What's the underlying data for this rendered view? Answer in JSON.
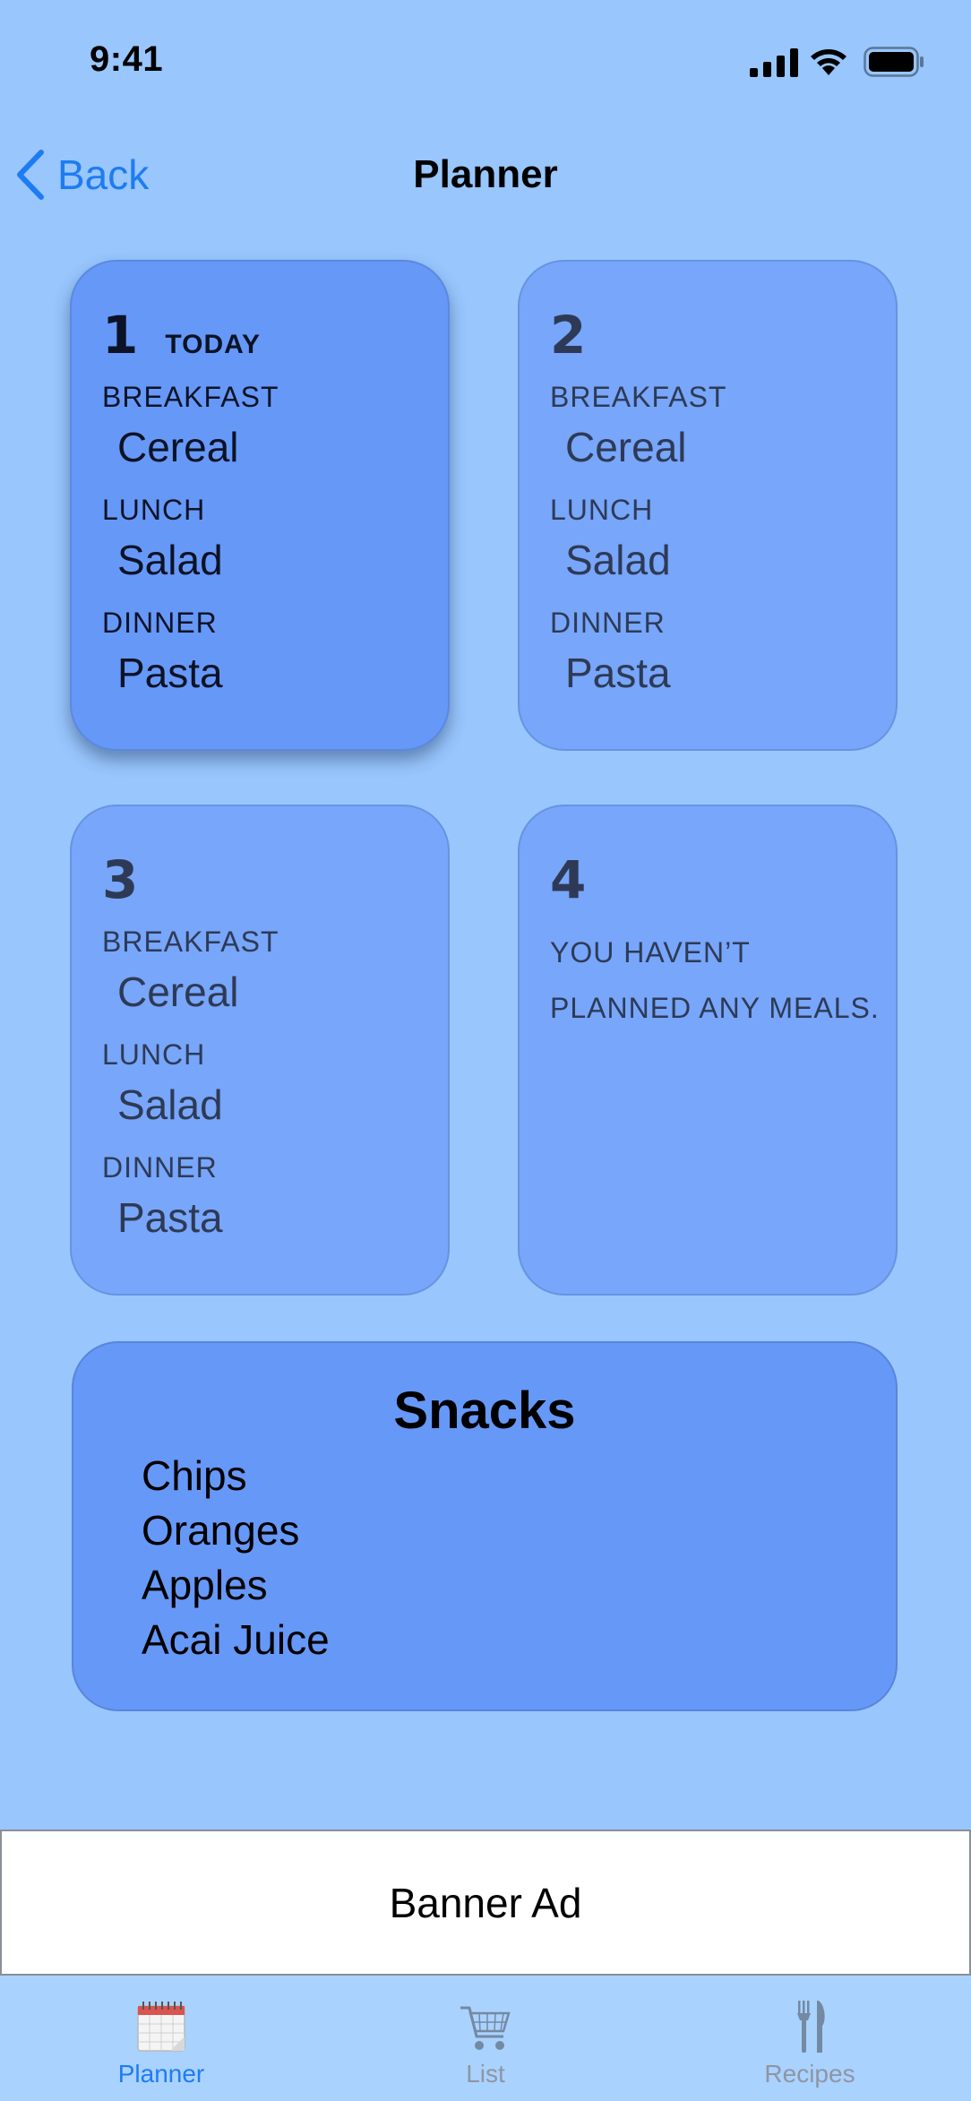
{
  "status_bar": {
    "time": "9:41"
  },
  "nav": {
    "back_label": "Back",
    "title": "Planner"
  },
  "days": [
    {
      "number": "1",
      "tag": "TODAY",
      "meals": [
        {
          "label": "BREAKFAST",
          "item": "Cereal"
        },
        {
          "label": "LUNCH",
          "item": "Salad"
        },
        {
          "label": "DINNER",
          "item": "Pasta"
        }
      ]
    },
    {
      "number": "2",
      "meals": [
        {
          "label": "BREAKFAST",
          "item": "Cereal"
        },
        {
          "label": "LUNCH",
          "item": "Salad"
        },
        {
          "label": "DINNER",
          "item": "Pasta"
        }
      ]
    },
    {
      "number": "3",
      "meals": [
        {
          "label": "BREAKFAST",
          "item": "Cereal"
        },
        {
          "label": "LUNCH",
          "item": "Salad"
        },
        {
          "label": "DINNER",
          "item": "Pasta"
        }
      ]
    },
    {
      "number": "4",
      "empty_line1": "YOU HAVEN’T",
      "empty_line2": "PLANNED ANY MEALS."
    }
  ],
  "snacks": {
    "title": "Snacks",
    "items": [
      "Chips",
      "Oranges",
      "Apples",
      "Acai Juice"
    ]
  },
  "banner": {
    "label": "Banner Ad"
  },
  "tabs": [
    {
      "label": "Planner",
      "icon": "calendar-icon",
      "active": true
    },
    {
      "label": "List",
      "icon": "cart-icon",
      "active": false
    },
    {
      "label": "Recipes",
      "icon": "fork-knife-icon",
      "active": false
    }
  ],
  "colors": {
    "background": "#98c6fd",
    "card": "#77a6fb",
    "card_today": "#6698f8",
    "accent": "#1e7cf2",
    "tab_bar": "#aad2fe"
  }
}
